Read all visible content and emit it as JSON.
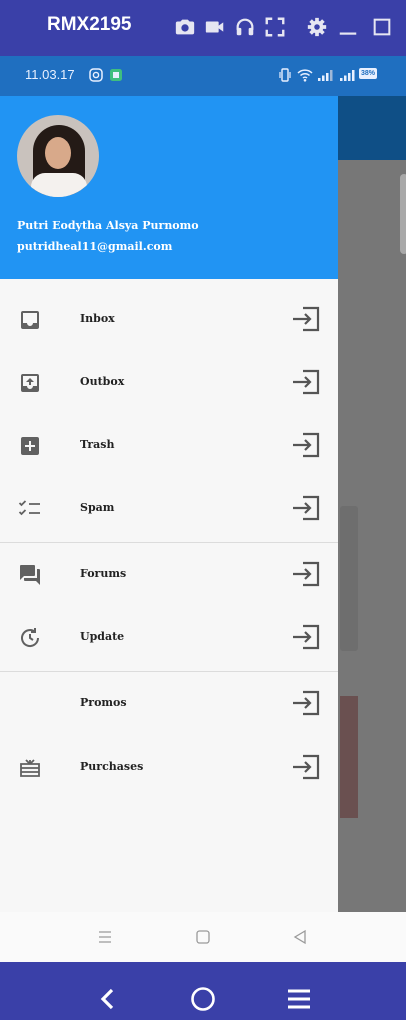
{
  "emulator": {
    "device_name": "RMX2195",
    "toolbar_icons": [
      "camera-icon",
      "video-camera-icon",
      "headphones-icon",
      "fullscreen-icon",
      "gear-icon",
      "minimize-icon",
      "maximize-icon"
    ],
    "bottom_nav": [
      "back-icon",
      "home-icon",
      "menu-icon"
    ],
    "bar_color": "#3a40a8"
  },
  "status_bar": {
    "time": "11.03.17",
    "battery": "38%"
  },
  "drawer": {
    "header_color": "#2194f3",
    "user": {
      "name": "Putri Eodytha Alsya Purnomo",
      "email": "putridheal11@gmail.com"
    },
    "groups": [
      {
        "items": [
          {
            "label": "Inbox",
            "icon": "inbox-icon"
          },
          {
            "label": "Outbox",
            "icon": "outbox-icon"
          },
          {
            "label": "Trash",
            "icon": "trash-plus-icon"
          },
          {
            "label": "Spam",
            "icon": "checklist-icon"
          }
        ]
      },
      {
        "items": [
          {
            "label": "Forums",
            "icon": "forum-icon"
          },
          {
            "label": "Update",
            "icon": "update-icon"
          }
        ]
      },
      {
        "items": [
          {
            "label": "Promos",
            "icon": ""
          },
          {
            "label": "Purchases",
            "icon": "gift-card-icon"
          }
        ]
      }
    ],
    "trailing_icon": "login-arrow-icon"
  },
  "phone_nav": [
    "recents-icon",
    "home-square-icon",
    "back-triangle-icon"
  ]
}
